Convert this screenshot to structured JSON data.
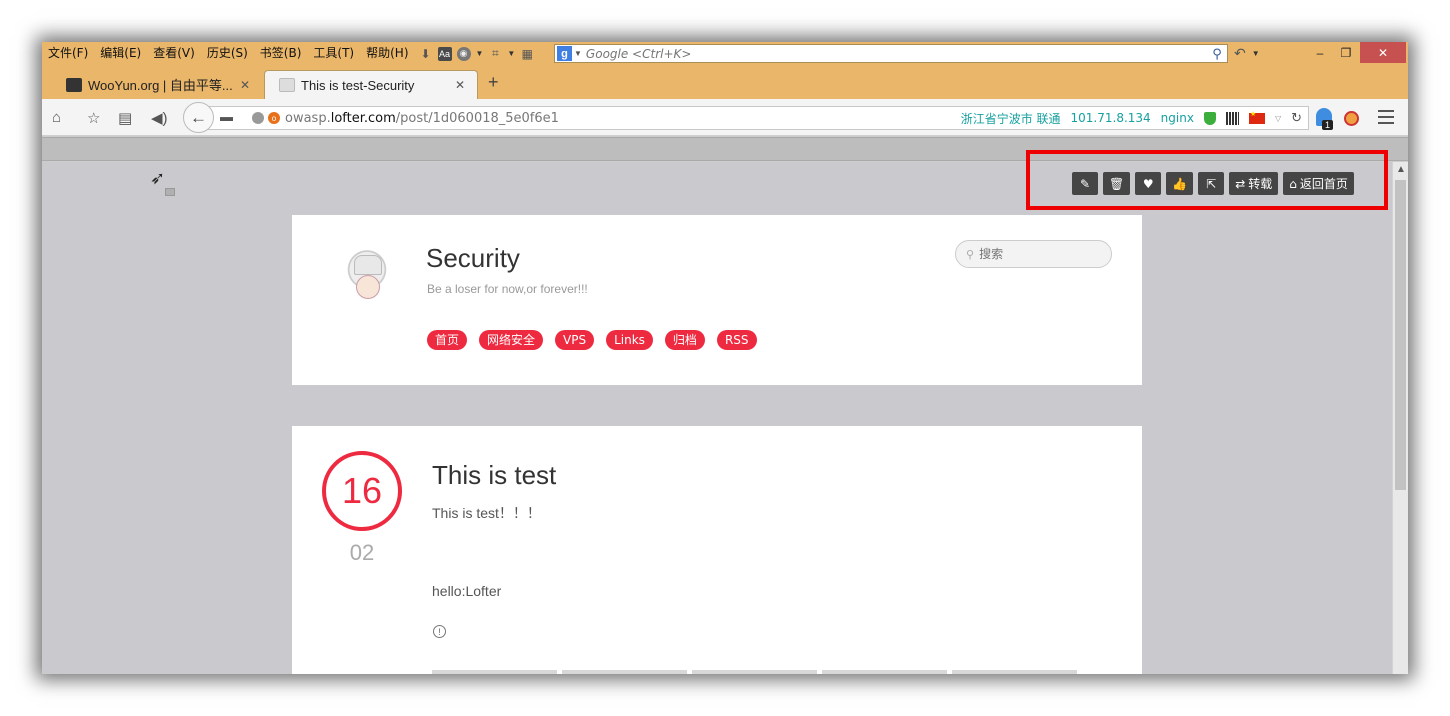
{
  "menubar": {
    "items": [
      "文件(F)",
      "编辑(E)",
      "查看(V)",
      "历史(S)",
      "书签(B)",
      "工具(T)",
      "帮助(H)"
    ],
    "search_placeholder": "Google <Ctrl+K>"
  },
  "tabs": [
    {
      "title": "WooYun.org | 自由平等...",
      "active": false
    },
    {
      "title": "This is test-Security",
      "active": true
    }
  ],
  "navbar": {
    "url_prefix": "owasp.",
    "url_domain": "lofter.com",
    "url_path": "/post/1d060018_5e0f6e1",
    "location": "浙江省宁波市 联通",
    "ip": "101.71.8.134",
    "server": "nginx",
    "ext_badge": "1"
  },
  "actions": {
    "repost_label": "转载",
    "home_label": "返回首页"
  },
  "blog": {
    "title": "Security",
    "subtitle": "Be a loser for now,or forever!!!",
    "search_placeholder": "搜索",
    "tags": [
      "首页",
      "网络安全",
      "VPS",
      "Links",
      "归档",
      "RSS"
    ]
  },
  "post": {
    "day": "16",
    "month": "02",
    "title": "This is test",
    "summary": "This is test！！！",
    "body": "hello:Lofter"
  },
  "colors": {
    "accent": "#ee2a40",
    "chrome": "#e9b66a",
    "highlight": "#ee0000"
  }
}
